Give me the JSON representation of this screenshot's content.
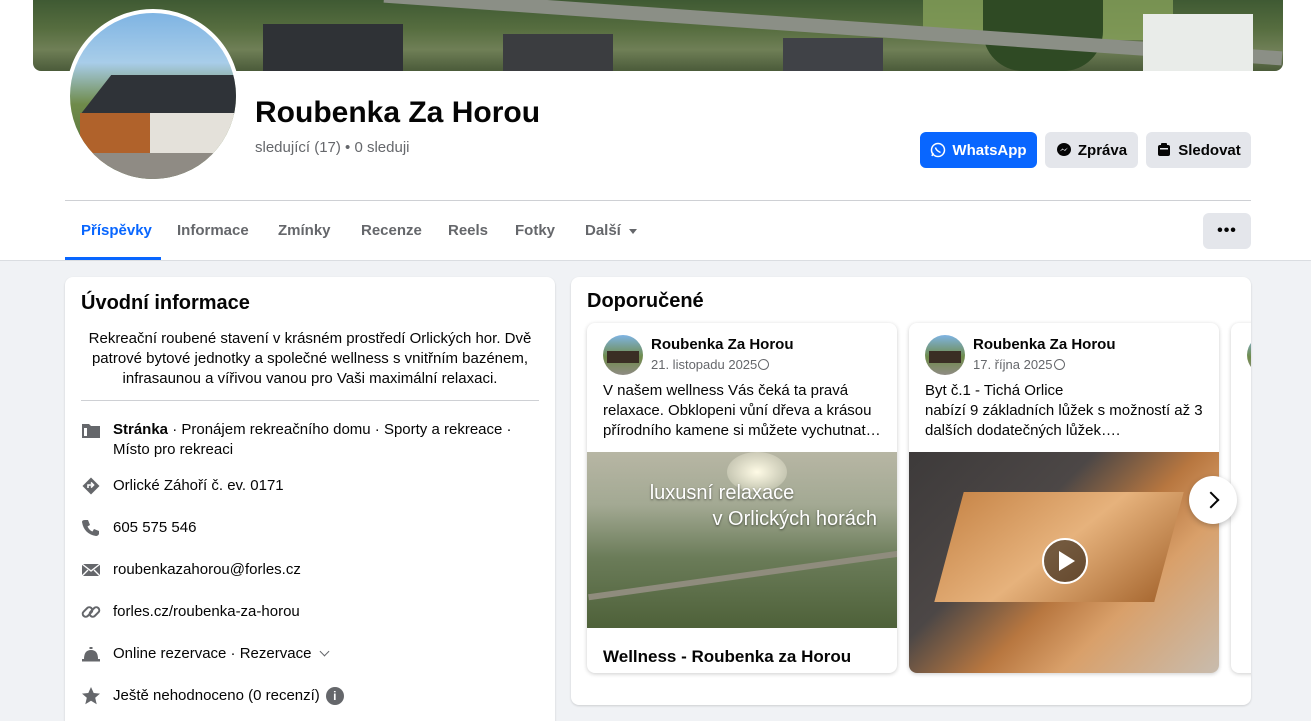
{
  "page": {
    "title": "Roubenka Za Horou",
    "followers": "sledující (17) • 0 sleduji"
  },
  "actions": {
    "whatsapp": "WhatsApp",
    "message": "Zpráva",
    "follow": "Sledovat",
    "more": "•••"
  },
  "tabs": [
    "Příspěvky",
    "Informace",
    "Zmínky",
    "Recenze",
    "Reels",
    "Fotky",
    "Další"
  ],
  "intro": {
    "heading": "Úvodní informace",
    "description": "Rekreační roubené stavení v krásném prostředí Orlických hor. Dvě patrové bytové jednotky a společné wellness s vnitřním bazénem, infrasaunou a vířivou vanou pro Vaši maximální relaxaci.",
    "category_label": "Stránka",
    "category_text": " · Pronájem rekreačního domu · Sporty a rekreace · Místo pro rekreaci",
    "address": "Orlické Záhoří č. ev. 0171",
    "phone": "605 575 546",
    "email": "roubenkazahorou@forles.cz",
    "website": "forles.cz/roubenka-za-horou",
    "booking": "Online rezervace · Rezervace",
    "rating": "Ještě nehodnoceno (0 recenzí)"
  },
  "recommended": {
    "heading": "Doporučené",
    "posts": [
      {
        "author": "Roubenka Za Horou",
        "date": "21. listopadu 2025",
        "text": "V našem wellness Vás čeká ta pravá relaxace. Obklopeni vůní dřeva a krásou přírodního kamene si můžete vychutnat…",
        "media_line1": "luxusní relaxace",
        "media_line2": "v Orlických horách",
        "footer": "Wellness - Roubenka za Horou"
      },
      {
        "author": "Roubenka Za Horou",
        "date": "17. října 2025",
        "text_line1": "Byt č.1 - Tichá Orlice",
        "text_line2": "nabízí 9 základních lůžek s možností až 3 dalších dodatečných lůžek…."
      }
    ]
  },
  "colors": {
    "accent": "#0866ff",
    "background": "#f0f2f5",
    "secondary_text": "#65676b"
  }
}
